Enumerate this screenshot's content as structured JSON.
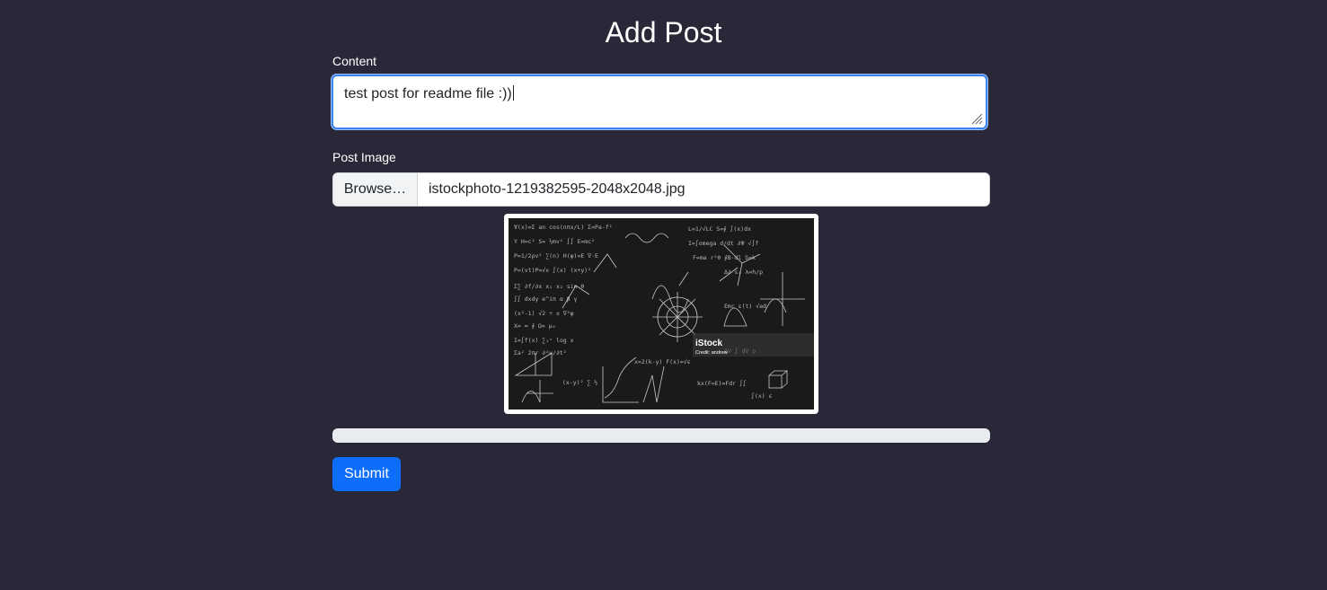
{
  "page": {
    "title": "Add Post"
  },
  "content_field": {
    "label": "Content",
    "value": "test post for readme file :))"
  },
  "image_field": {
    "label": "Post Image",
    "browse_label": "Browse…",
    "filename": "istockphoto-1219382595-2048x2048.jpg"
  },
  "preview": {
    "watermark": "iStock",
    "credit": "Credit: andrew"
  },
  "progress": {
    "value_percent": 0
  },
  "submit": {
    "label": "Submit"
  },
  "colors": {
    "background": "#2a2838",
    "primary": "#0d6efd",
    "focus_border": "#3b82f6"
  }
}
